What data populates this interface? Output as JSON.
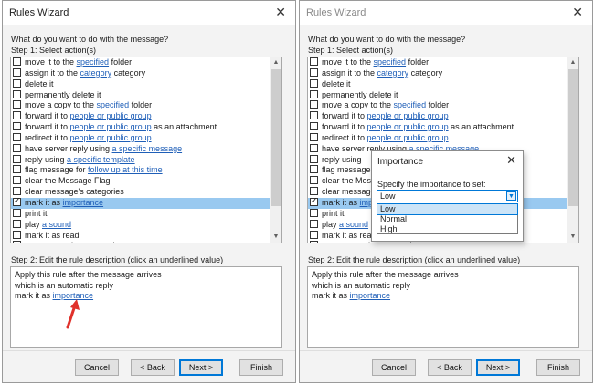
{
  "left": {
    "title": "Rules Wizard",
    "prompt": "What do you want to do with the message?",
    "step1": "Step 1: Select action(s)",
    "actions": [
      {
        "parts": [
          {
            "t": "move it to the "
          },
          {
            "t": "specified",
            "l": true
          },
          {
            "t": " folder"
          }
        ],
        "checked": false,
        "selected": false
      },
      {
        "parts": [
          {
            "t": "assign it to the "
          },
          {
            "t": "category",
            "l": true
          },
          {
            "t": " category"
          }
        ],
        "checked": false,
        "selected": false
      },
      {
        "parts": [
          {
            "t": "delete it"
          }
        ],
        "checked": false,
        "selected": false
      },
      {
        "parts": [
          {
            "t": "permanently delete it"
          }
        ],
        "checked": false,
        "selected": false
      },
      {
        "parts": [
          {
            "t": "move a copy to the "
          },
          {
            "t": "specified",
            "l": true
          },
          {
            "t": " folder"
          }
        ],
        "checked": false,
        "selected": false
      },
      {
        "parts": [
          {
            "t": "forward it to "
          },
          {
            "t": "people or public group",
            "l": true
          }
        ],
        "checked": false,
        "selected": false
      },
      {
        "parts": [
          {
            "t": "forward it to "
          },
          {
            "t": "people or public group",
            "l": true
          },
          {
            "t": " as an attachment"
          }
        ],
        "checked": false,
        "selected": false
      },
      {
        "parts": [
          {
            "t": "redirect it to "
          },
          {
            "t": "people or public group",
            "l": true
          }
        ],
        "checked": false,
        "selected": false
      },
      {
        "parts": [
          {
            "t": "have server reply using "
          },
          {
            "t": "a specific message",
            "l": true
          }
        ],
        "checked": false,
        "selected": false
      },
      {
        "parts": [
          {
            "t": "reply using "
          },
          {
            "t": "a specific template",
            "l": true
          }
        ],
        "checked": false,
        "selected": false
      },
      {
        "parts": [
          {
            "t": "flag message for "
          },
          {
            "t": "follow up at this time",
            "l": true
          }
        ],
        "checked": false,
        "selected": false
      },
      {
        "parts": [
          {
            "t": "clear the Message Flag"
          }
        ],
        "checked": false,
        "selected": false
      },
      {
        "parts": [
          {
            "t": "clear message's categories"
          }
        ],
        "checked": false,
        "selected": false
      },
      {
        "parts": [
          {
            "t": "mark it as "
          },
          {
            "t": "importance",
            "l": true
          }
        ],
        "checked": true,
        "selected": true
      },
      {
        "parts": [
          {
            "t": "print it"
          }
        ],
        "checked": false,
        "selected": false
      },
      {
        "parts": [
          {
            "t": "play "
          },
          {
            "t": "a sound",
            "l": true
          }
        ],
        "checked": false,
        "selected": false
      },
      {
        "parts": [
          {
            "t": "mark it as read"
          }
        ],
        "checked": false,
        "selected": false
      },
      {
        "parts": [
          {
            "t": "stop processing more rules"
          }
        ],
        "checked": false,
        "selected": false
      }
    ],
    "step2": "Step 2: Edit the rule description (click an underlined value)",
    "desc": {
      "line1": "Apply this rule after the message arrives",
      "line2": "which is an automatic reply",
      "line3_text": "mark it as ",
      "line3_link": "importance"
    },
    "buttons": {
      "cancel": "Cancel",
      "back": "< Back",
      "next": "Next >",
      "finish": "Finish"
    }
  },
  "right": {
    "title": "Rules Wizard",
    "prompt": "What do you want to do with the message?",
    "step1": "Step 1: Select action(s)",
    "actions": [
      {
        "parts": [
          {
            "t": "move it to the "
          },
          {
            "t": "specified",
            "l": true
          },
          {
            "t": " folder"
          }
        ],
        "checked": false,
        "selected": false
      },
      {
        "parts": [
          {
            "t": "assign it to the "
          },
          {
            "t": "category",
            "l": true
          },
          {
            "t": " category"
          }
        ],
        "checked": false,
        "selected": false
      },
      {
        "parts": [
          {
            "t": "delete it"
          }
        ],
        "checked": false,
        "selected": false
      },
      {
        "parts": [
          {
            "t": "permanently delete it"
          }
        ],
        "checked": false,
        "selected": false
      },
      {
        "parts": [
          {
            "t": "move a copy to the "
          },
          {
            "t": "specified",
            "l": true
          },
          {
            "t": " folder"
          }
        ],
        "checked": false,
        "selected": false
      },
      {
        "parts": [
          {
            "t": "forward it to "
          },
          {
            "t": "people or public group",
            "l": true
          }
        ],
        "checked": false,
        "selected": false
      },
      {
        "parts": [
          {
            "t": "forward it to "
          },
          {
            "t": "people or public group",
            "l": true
          },
          {
            "t": " as an attachment"
          }
        ],
        "checked": false,
        "selected": false
      },
      {
        "parts": [
          {
            "t": "redirect it to "
          },
          {
            "t": "people or public group",
            "l": true
          }
        ],
        "checked": false,
        "selected": false
      },
      {
        "parts": [
          {
            "t": "have server reply using "
          },
          {
            "t": "a specific message",
            "l": true
          }
        ],
        "checked": false,
        "selected": false
      },
      {
        "parts": [
          {
            "t": "reply using "
          }
        ],
        "checked": false,
        "selected": false
      },
      {
        "parts": [
          {
            "t": "flag message f"
          }
        ],
        "checked": false,
        "selected": false
      },
      {
        "parts": [
          {
            "t": "clear the Message"
          }
        ],
        "checked": false,
        "selected": false
      },
      {
        "parts": [
          {
            "t": "clear message's"
          }
        ],
        "checked": false,
        "selected": false
      },
      {
        "parts": [
          {
            "t": "mark it as "
          },
          {
            "t": "imp",
            "l": true
          }
        ],
        "checked": true,
        "selected": true
      },
      {
        "parts": [
          {
            "t": "print it"
          }
        ],
        "checked": false,
        "selected": false
      },
      {
        "parts": [
          {
            "t": "play "
          },
          {
            "t": "a sound",
            "l": true
          }
        ],
        "checked": false,
        "selected": false
      },
      {
        "parts": [
          {
            "t": "mark it as read"
          }
        ],
        "checked": false,
        "selected": false
      },
      {
        "parts": [
          {
            "t": "stop processing more rules"
          }
        ],
        "checked": false,
        "selected": false
      }
    ],
    "step2": "Step 2: Edit the rule description (click an underlined value)",
    "desc": {
      "line1": "Apply this rule after the message arrives",
      "line2": "which is an automatic reply",
      "line3_text": "mark it as ",
      "line3_link": "importance"
    },
    "buttons": {
      "cancel": "Cancel",
      "back": "< Back",
      "next": "Next >",
      "finish": "Finish"
    },
    "popup": {
      "title": "Importance",
      "label": "Specify the importance to set:",
      "selected_value": "Low",
      "options": [
        "Low",
        "Normal",
        "High"
      ]
    }
  },
  "colors": {
    "link": "#1f5fb8",
    "selection": "#99c9f0",
    "annotation_arrow": "#e0312b"
  }
}
